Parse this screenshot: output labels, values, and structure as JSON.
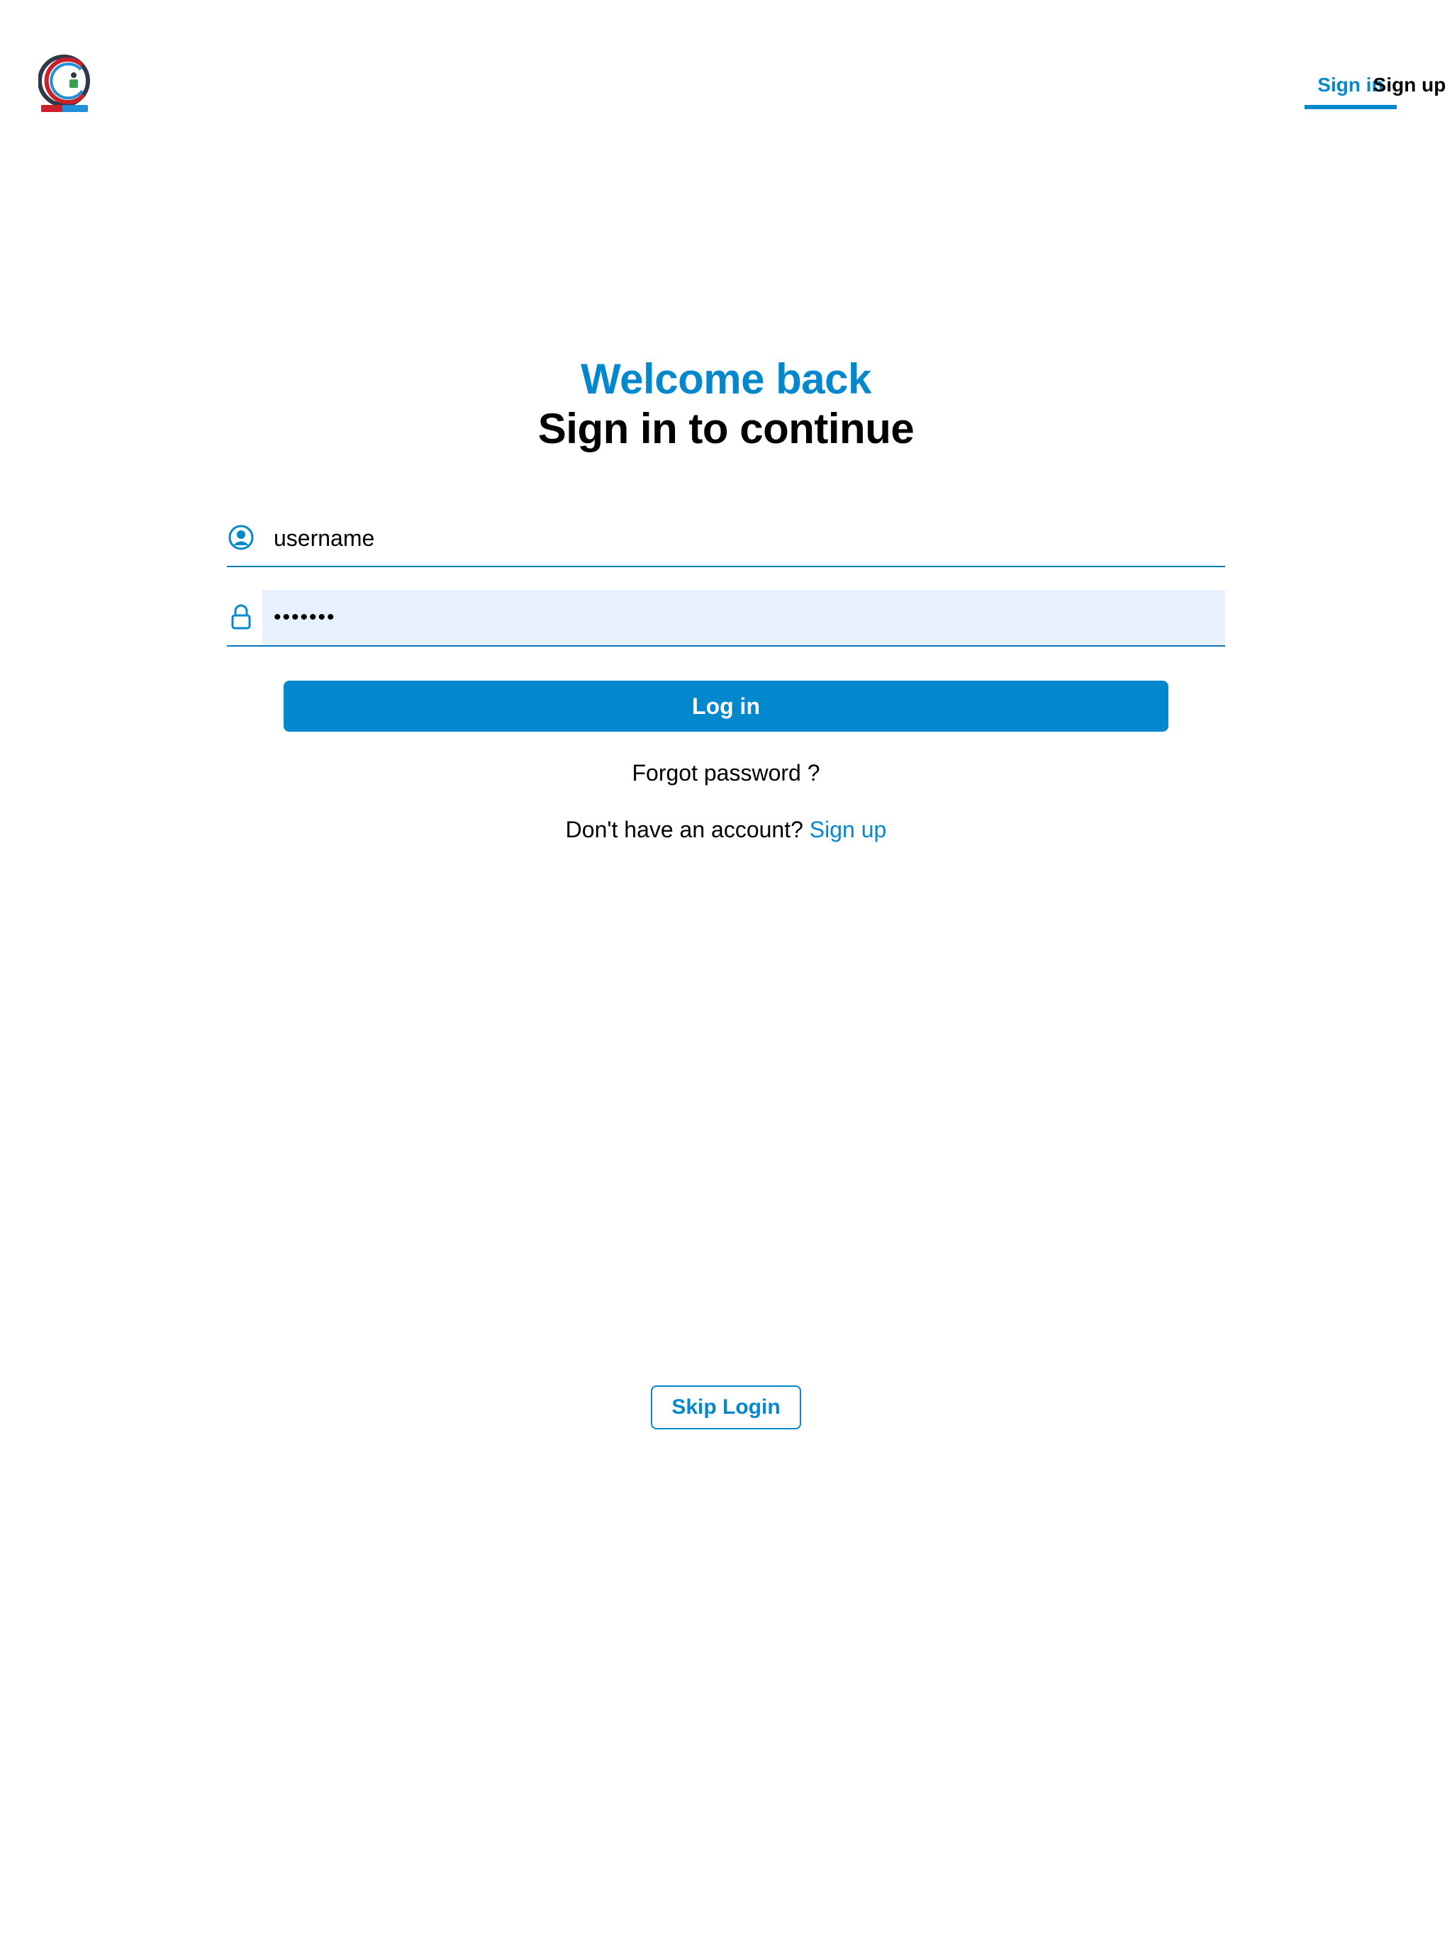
{
  "header": {
    "logo_icon": "app-logo",
    "tabs": {
      "sign_in": "Sign in",
      "sign_up": "Sign up"
    }
  },
  "title": {
    "welcome": "Welcome back",
    "subtitle": "Sign in to continue"
  },
  "form": {
    "username": {
      "icon": "user-circle-icon",
      "value": "username"
    },
    "password": {
      "icon": "lock-icon",
      "value": "•••••••"
    },
    "login_label": "Log in",
    "forgot_label": "Forgot password ?",
    "no_account_text": "Don't have an account?",
    "signup_link": "Sign up"
  },
  "skip_label": "Skip Login",
  "colors": {
    "accent": "#0488cd",
    "password_field_bg": "#e7f0fd",
    "text": "#000000",
    "background": "#ffffff"
  }
}
